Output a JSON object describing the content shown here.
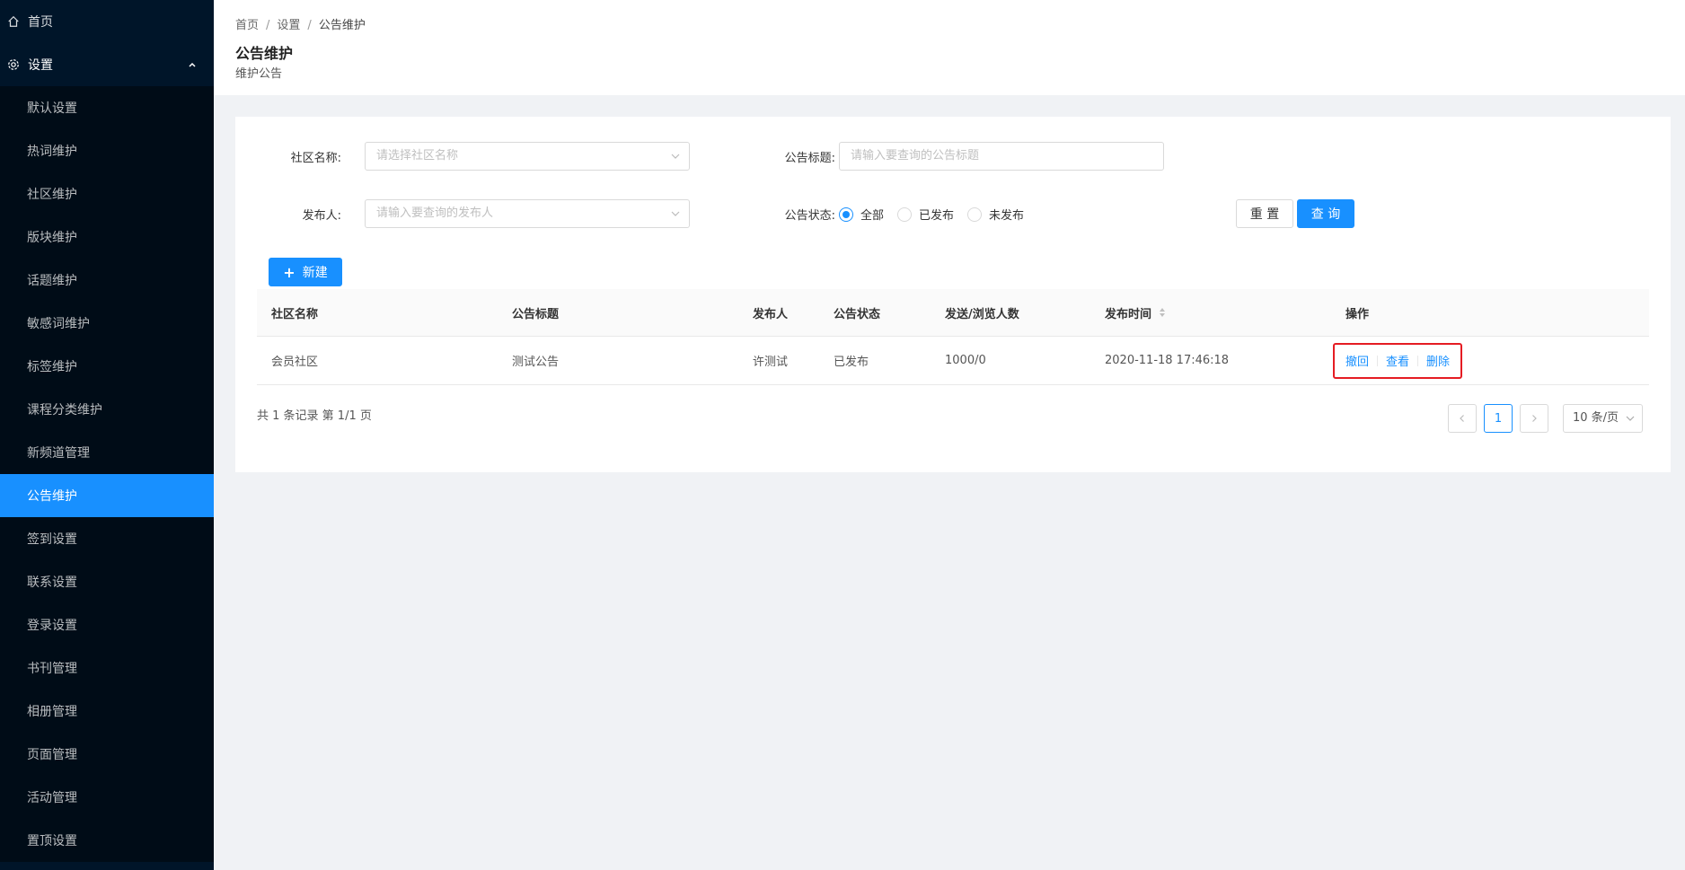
{
  "sidebar": {
    "home": "首页",
    "settings": "设置",
    "children": [
      "默认设置",
      "热词维护",
      "社区维护",
      "版块维护",
      "话题维护",
      "敏感词维护",
      "标签维护",
      "课程分类维护",
      "新频道管理",
      "公告维护",
      "签到设置",
      "联系设置",
      "登录设置",
      "书刊管理",
      "相册管理",
      "页面管理",
      "活动管理",
      "置顶设置"
    ],
    "active": "公告维护",
    "accent": "#1890ff"
  },
  "breadcrumb": [
    "首页",
    "设置",
    "公告维护"
  ],
  "header": {
    "title": "公告维护",
    "subtitle": "维护公告"
  },
  "filters": {
    "community_label": "社区名称:",
    "community_placeholder": "请选择社区名称",
    "title_label": "公告标题:",
    "title_placeholder": "请输入要查询的公告标题",
    "publisher_label": "发布人:",
    "publisher_placeholder": "请输入要查询的发布人",
    "status_label": "公告状态:",
    "status_options": [
      "全部",
      "已发布",
      "未发布"
    ],
    "status_selected": "全部",
    "reset": "重 置",
    "query": "查 询"
  },
  "new_button": "新建",
  "table": {
    "columns": [
      "社区名称",
      "公告标题",
      "发布人",
      "公告状态",
      "发送/浏览人数",
      "发布时间",
      "操作"
    ],
    "rows": [
      {
        "community": "会员社区",
        "title": "测试公告",
        "publisher": "许测试",
        "status": "已发布",
        "counts": "1000/0",
        "time": "2020-11-18 17:46:18",
        "actions": [
          "撤回",
          "查看",
          "删除"
        ]
      }
    ]
  },
  "pagination": {
    "summary": "共 1 条记录 第 1/1 页",
    "current": "1",
    "page_size": "10 条/页"
  }
}
